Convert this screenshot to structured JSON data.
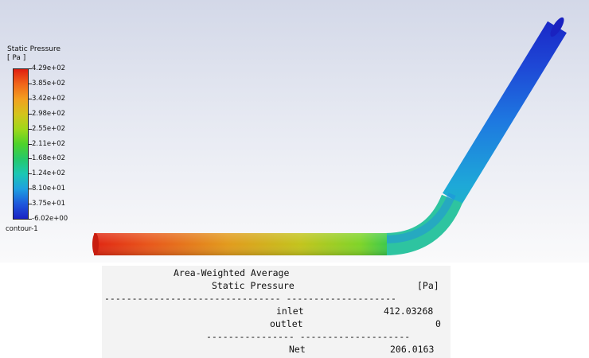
{
  "legend": {
    "title_line1": "Static Pressure",
    "title_line2": "[ Pa ]",
    "ticks": [
      "4.29e+02",
      "3.85e+02",
      "3.42e+02",
      "2.98e+02",
      "2.55e+02",
      "2.11e+02",
      "1.68e+02",
      "1.24e+02",
      "8.10e+01",
      "3.75e+01",
      "-6.02e+00"
    ],
    "name": "contour-1",
    "colors": [
      "#e01f10",
      "#f0661a",
      "#f2a020",
      "#d4c41c",
      "#9fd81a",
      "#4ed22a",
      "#26c86a",
      "#1cc7b4",
      "#1ea0e0",
      "#1e58dc",
      "#1a22c4"
    ]
  },
  "report": {
    "header_line1": "Area-Weighted Average",
    "header_line2": "Static Pressure",
    "unit": "[Pa]",
    "rows": [
      {
        "label": "inlet",
        "value": "412.03268"
      },
      {
        "label": "outlet",
        "value": "0"
      }
    ],
    "net_label": "Net",
    "net_value": "206.0163"
  }
}
